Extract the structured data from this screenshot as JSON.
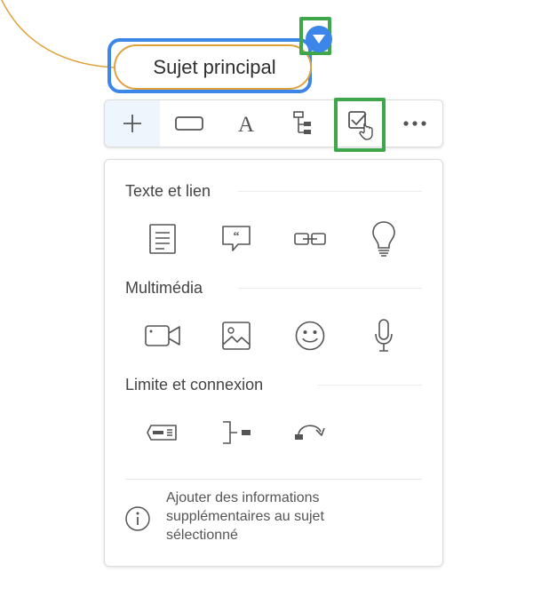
{
  "topic": {
    "label": "Sujet principal"
  },
  "toolbar": {
    "items": [
      {
        "icon": "plus-icon"
      },
      {
        "icon": "topic-shape-icon"
      },
      {
        "icon": "text-format-icon"
      },
      {
        "icon": "structure-icon"
      },
      {
        "icon": "task-checkbox-icon"
      },
      {
        "icon": "more-icon"
      }
    ]
  },
  "panel": {
    "sections": [
      {
        "title": "Texte et lien",
        "icons": [
          "note-icon",
          "comment-icon",
          "link-icon",
          "idea-bulb-icon"
        ]
      },
      {
        "title": "Multimédia",
        "icons": [
          "video-icon",
          "image-icon",
          "emoji-icon",
          "microphone-icon"
        ]
      },
      {
        "title": "Limite et connexion",
        "icons": [
          "boundary-icon",
          "summary-icon",
          "relationship-icon"
        ]
      }
    ],
    "info_text": "Ajouter des informations supplémentaires au sujet sélectionné"
  },
  "colors": {
    "accent_blue": "#3b86e8",
    "highlight_green": "#3fa64a",
    "topic_border": "#e1a13a",
    "icon_gray": "#555555"
  }
}
